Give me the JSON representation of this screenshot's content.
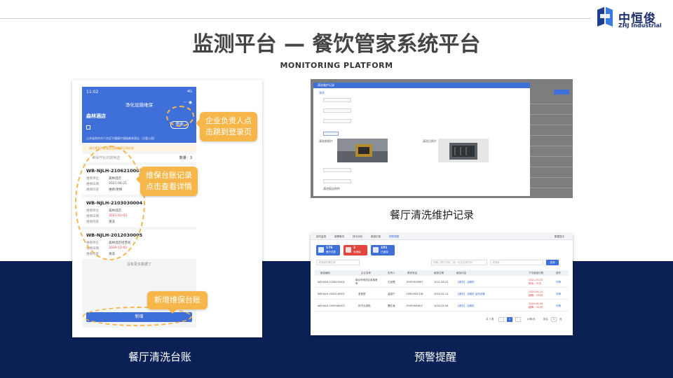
{
  "header": {
    "title": "监测平台 — 餐饮管家系统平台",
    "subtitle": "MONITORING PLATFORM",
    "logo": {
      "name_cn": "中恒俊",
      "name_en": "ZHJ Industrial"
    }
  },
  "colors": {
    "navy": "#0b2156",
    "accent": "#f7b64a",
    "primary": "#3f6fd8"
  },
  "phone": {
    "time": "11:02",
    "status_right": "4G",
    "nav_title": "净化设施维保",
    "hotel": "森林酒店",
    "login_button": "登录",
    "address": "江苏省南京市六合区竹镇镇竹镇路森林酒店（天鹿公园）",
    "notice": "请注意及时查看此设备维保记录信息",
    "filter_label": "维保开始日期筛选",
    "count_label": "数量：",
    "count_value": "3",
    "records": [
      {
        "id": "WB-NJLH-2106210001",
        "unit_label": "维保单位",
        "unit": "森林酒店",
        "date_label": "维保日期",
        "date": "2021-06-21",
        "content_label": "维保内容",
        "content": "维修/更换"
      },
      {
        "id": "WB-NJLH-2103030004",
        "unit_label": "维保单位",
        "unit": "森林酒店",
        "date_label": "维保日期",
        "date": "2021-03-03",
        "content_label": "维保内容",
        "content": "清洗"
      },
      {
        "id": "WB-NJLH-2012030005",
        "unit_label": "维保单位",
        "unit": "森林酒店经营商",
        "date_label": "维保日期",
        "date": "2020-12-03",
        "content_label": "维保内容",
        "content": "清洗"
      }
    ],
    "no_more": "没有更多数据了",
    "add_button": "新增"
  },
  "callouts": {
    "login": [
      "企业负责人点",
      "击跳到登录页"
    ],
    "records": [
      "维保台账记录",
      "点击查看详情"
    ],
    "add": "新增维保台账"
  },
  "captions": {
    "ledger": "餐厅清洗台账",
    "maintenance": "餐厅清洗维护记录",
    "warning": "预警提醒"
  },
  "maintenance_shot": {
    "dialog_title": "清洗维护记录",
    "section": "清洗",
    "before_label": "清洗前照片",
    "after_label": "清洗后照片",
    "file_label": "清洗报告附件"
  },
  "warning_shot": {
    "tabs": [
      "实时监测",
      "报警概况",
      "排污分析",
      "维保记录",
      "预警提醒"
    ],
    "tab_right": "数据显示",
    "cards": [
      {
        "num": "176",
        "label": "餐厅总数",
        "color": "#3f6fd8"
      },
      {
        "num": "2",
        "label": "未维保",
        "color": "#e2463f"
      },
      {
        "num": "101",
        "label": "已维保",
        "color": "#3f6fd8"
      }
    ],
    "search_placeholder_1": "请选择所属区域",
    "search_placeholder_2": "请输入餐厅名称、统一社会信用代码",
    "search_placeholder_3": "请选择",
    "search_button": "查询",
    "columns": [
      "维保编码",
      "企业名称",
      "负责人",
      "联系电话",
      "维保日期",
      "维保内容",
      "下次维保日期",
      "操作"
    ],
    "rows": [
      {
        "code": "WB-NJLH-2106220001",
        "name": "南京市雨花区某某食府",
        "person": "王经理",
        "phone": "15951909907",
        "date": "2021-06-22",
        "content": "【清洗】 油烟机",
        "next": "2021-09-22",
        "next_note": "剩余：91天",
        "op": "详情"
      },
      {
        "code": "WB-NJLH-2005140001",
        "name": "老食堂",
        "person": "孟晓宁",
        "phone": "13851961318",
        "date": "2020-05-14",
        "content": "【清洗】 油烟机 监测设备",
        "next": "2020-08-14",
        "next_note": "超期：343天",
        "op": "详情"
      },
      {
        "code": "WB-NJLH-2005060007",
        "name": "好巧大排档",
        "person": "曹红涛",
        "phone": "15951960617",
        "date": "2020-05-06",
        "content": "【清洗】 油烟机",
        "next": "2020-08-06",
        "next_note": "超期：351天",
        "op": "详情"
      }
    ],
    "pager": {
      "total": "共 3 条",
      "page": "1",
      "size": "10条/页",
      "goto_label": "前往",
      "goto_page": "1",
      "goto_unit": "页"
    }
  }
}
